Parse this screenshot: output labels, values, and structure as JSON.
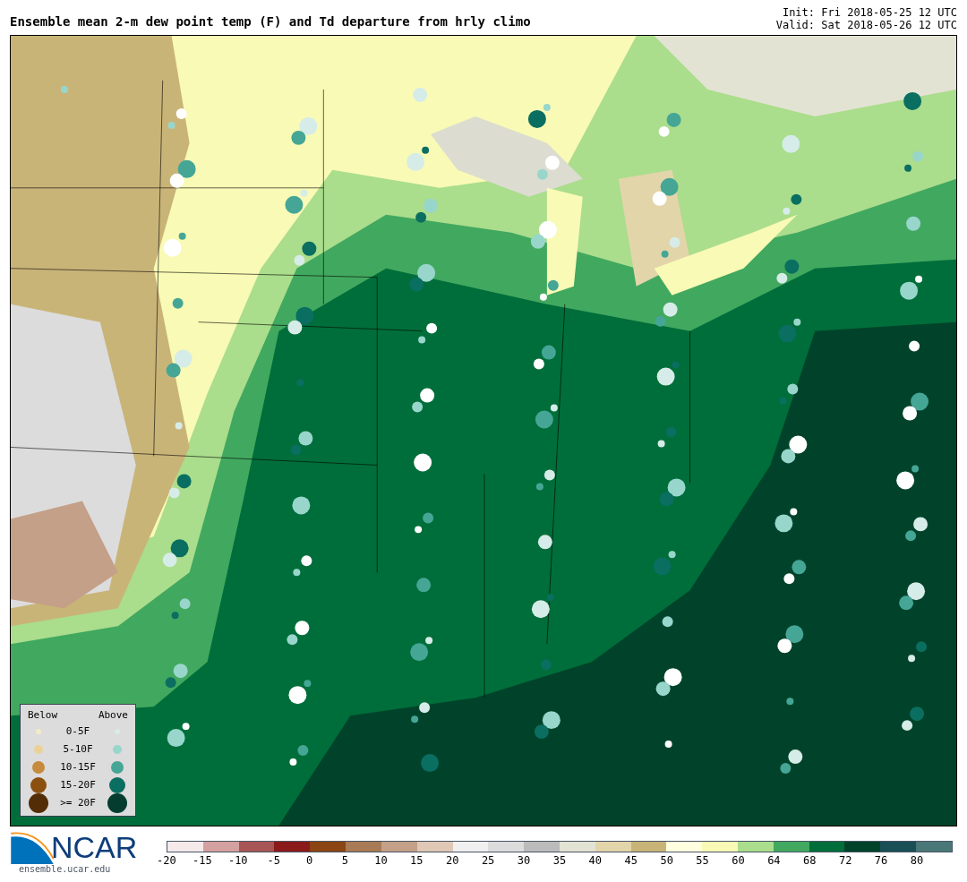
{
  "title": "Ensemble mean 2-m dew point temp (F) and Td departure from hrly climo",
  "run_info": [
    "Init: Fri 2018-05-25 12 UTC",
    "Valid: Sat 2018-05-26 12 UTC"
  ],
  "legend": {
    "below_heading": "Below",
    "above_heading": "Above",
    "rows": [
      {
        "label": "0-5F",
        "below": {
          "color": "#f3ebc8"
        },
        "above": {
          "color": "#d6ece8"
        }
      },
      {
        "label": "5-10F",
        "below": {
          "color": "#ecd196"
        },
        "above": {
          "color": "#98d6cc"
        }
      },
      {
        "label": "10-15F",
        "below": {
          "color": "#c68b3c"
        },
        "above": {
          "color": "#45a696"
        }
      },
      {
        "label": "15-20F",
        "below": {
          "color": "#8b5010"
        },
        "above": {
          "color": "#0a6e60"
        }
      },
      {
        "label": ">= 20F",
        "below": {
          "color": "#532d05"
        },
        "above": {
          "color": "#043d30"
        }
      }
    ]
  },
  "logo": {
    "wordmark": "NCAR",
    "url": "ensemble.ucar.edu"
  },
  "colorbar": [
    {
      "label": "-20",
      "color": "#f5e9e9"
    },
    {
      "label": "-15",
      "color": "#d4a0a0"
    },
    {
      "label": "-10",
      "color": "#a85555"
    },
    {
      "label": "-5",
      "color": "#8b1a1a"
    },
    {
      "label": "0",
      "color": "#8b4513"
    },
    {
      "label": "5",
      "color": "#a87a55"
    },
    {
      "label": "10",
      "color": "#c4a088"
    },
    {
      "label": "15",
      "color": "#dfc8b5"
    },
    {
      "label": "20",
      "color": "#f0f0f0"
    },
    {
      "label": "25",
      "color": "#dcdcdc"
    },
    {
      "label": "30",
      "color": "#bbbbbb"
    },
    {
      "label": "35",
      "color": "#e3e3d3"
    },
    {
      "label": "40",
      "color": "#e3d5aa"
    },
    {
      "label": "45",
      "color": "#c9b478"
    },
    {
      "label": "50",
      "color": "#ffffe0"
    },
    {
      "label": "55",
      "color": "#f8fab5"
    },
    {
      "label": "60",
      "color": "#aadd8c"
    },
    {
      "label": "64",
      "color": "#41a85f"
    },
    {
      "label": "68",
      "color": "#006e3a"
    },
    {
      "label": "72",
      "color": "#00432a"
    },
    {
      "label": "76",
      "color": "#1a4f55"
    },
    {
      "label": "80",
      "color": "#4a7878"
    }
  ]
}
